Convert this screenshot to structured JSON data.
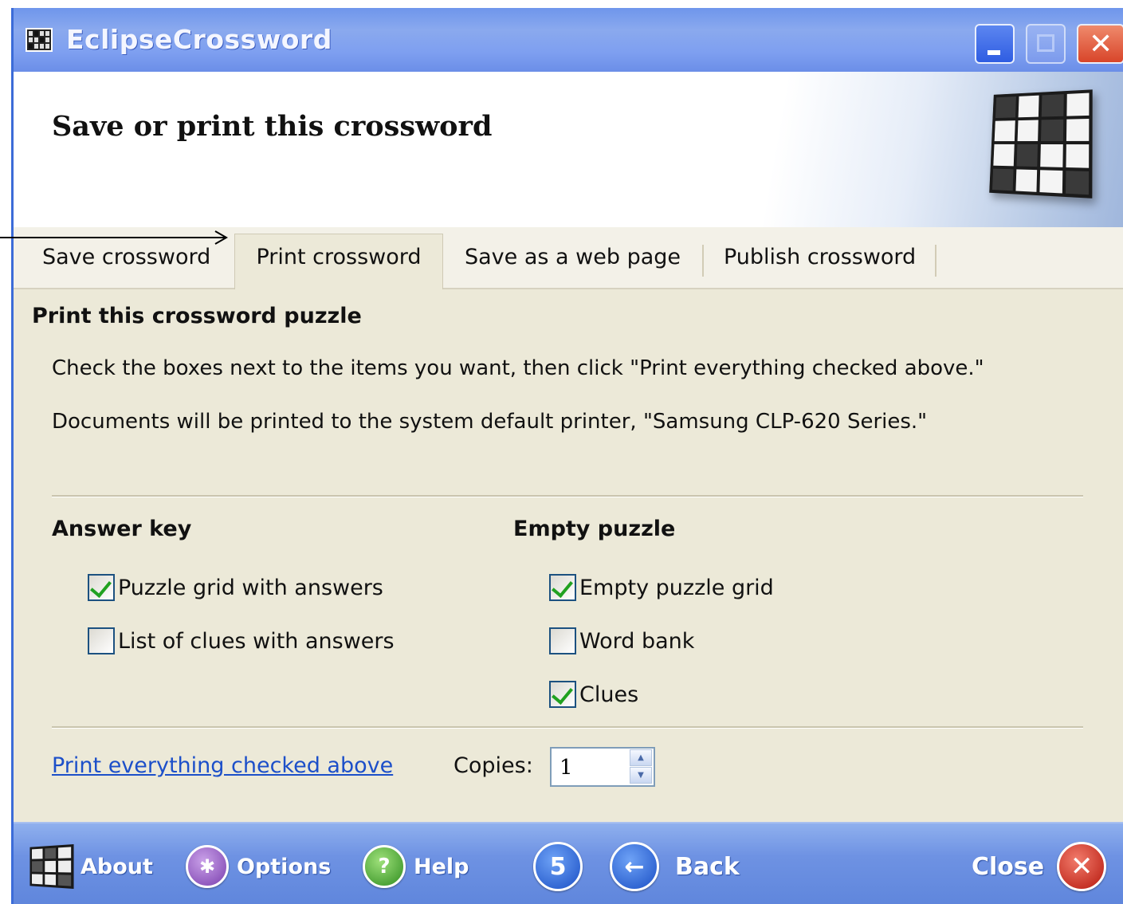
{
  "window": {
    "title": "EclipseCrossword",
    "controls": {
      "minimize_icon": "minimize-icon",
      "maximize_icon": "maximize-icon",
      "close_glyph": "✕"
    }
  },
  "header": {
    "title": "Save or print this crossword",
    "logo_icon": "crossword-grid-logo"
  },
  "tabs": [
    {
      "label": "Save crossword",
      "selected": false
    },
    {
      "label": "Print crossword",
      "selected": true
    },
    {
      "label": "Save as a web page",
      "selected": false
    },
    {
      "label": "Publish crossword",
      "selected": false
    }
  ],
  "content": {
    "heading": "Print this crossword puzzle",
    "instruction1": "Check the boxes next to the items you want, then click \"Print everything checked above.\"",
    "instruction2": "Documents will be printed to the system default printer, \"Samsung CLP-620 Series.\"",
    "answer_key": {
      "heading": "Answer key",
      "items": [
        {
          "label": "Puzzle grid with answers",
          "checked": true
        },
        {
          "label": "List of clues with answers",
          "checked": false
        }
      ]
    },
    "empty_puzzle": {
      "heading": "Empty puzzle",
      "items": [
        {
          "label": "Empty puzzle grid",
          "checked": true
        },
        {
          "label": "Word bank",
          "checked": false
        },
        {
          "label": "Clues",
          "checked": true
        }
      ]
    },
    "print_link": "Print everything checked above",
    "copies_label": "Copies:",
    "copies_value": "1"
  },
  "footer": {
    "about": "About",
    "options": "Options",
    "help": "Help",
    "five_glyph": "5",
    "back": "Back",
    "close": "Close",
    "options_glyph": "✱",
    "help_glyph": "?",
    "back_glyph": "←",
    "close_glyph": "✕"
  },
  "colors": {
    "titlebar": "#7e9ff0",
    "window_bg": "#ece9d8",
    "link": "#1c4fc9",
    "check": "#21a121",
    "footer": "#6e92e3"
  }
}
